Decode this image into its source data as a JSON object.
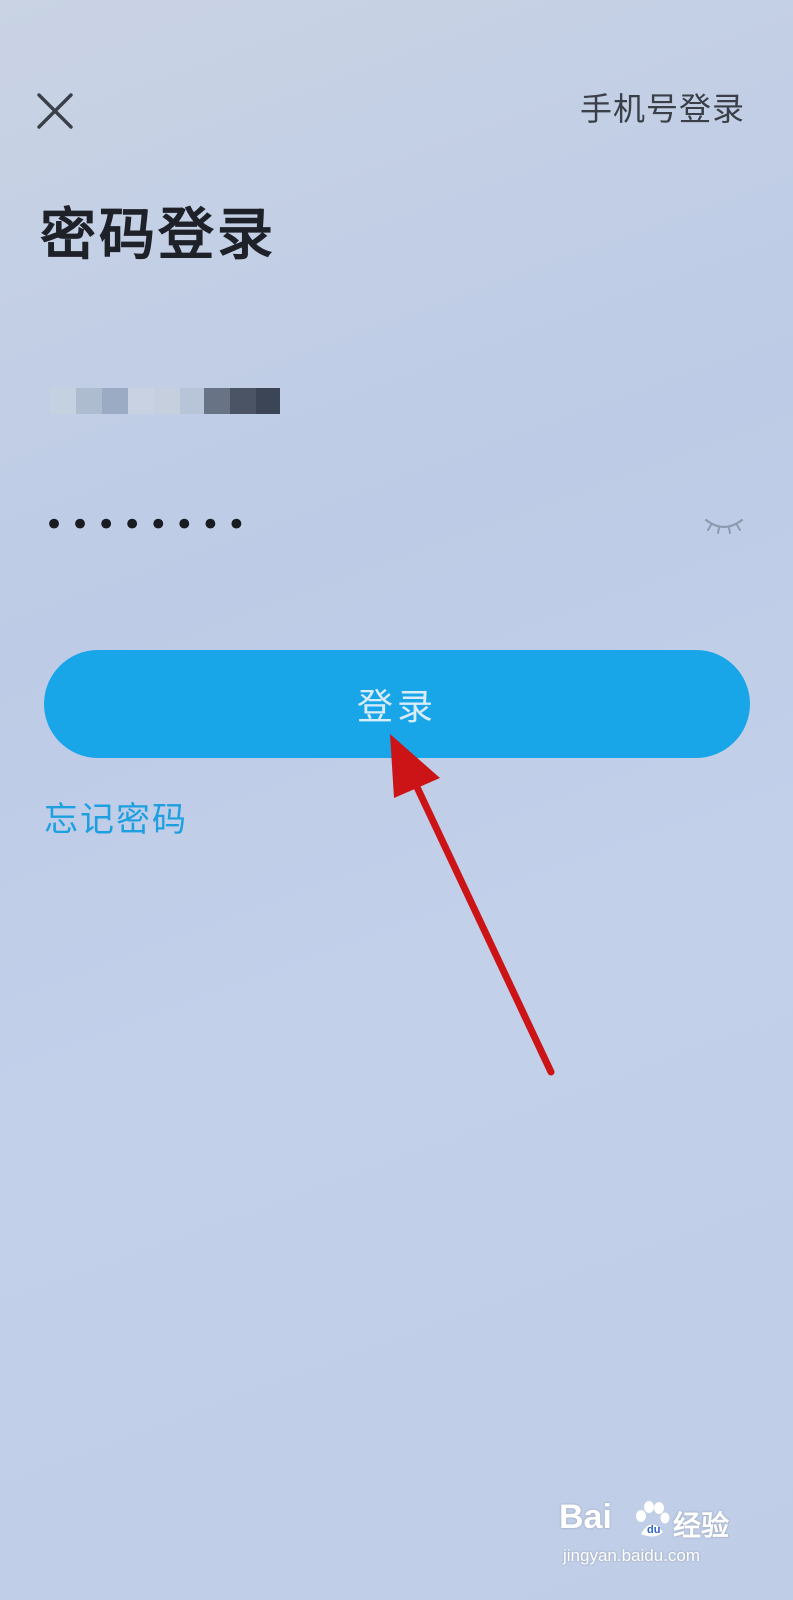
{
  "header": {
    "close_icon": "close-icon",
    "phone_login_label": "手机号登录"
  },
  "title": "密码登录",
  "account": {
    "value_state": "masked",
    "blocks": [
      "#c4d1e1",
      "#aebcd0",
      "#9aabc3",
      "#c8d2e2",
      "#c5cfde",
      "#b8c4d8",
      "#687386",
      "#4a5464",
      "#3b4555"
    ]
  },
  "password": {
    "value": "••••••••",
    "toggle_icon": "eye-closed-icon"
  },
  "login_button": {
    "label": "登录",
    "color": "#19a6e8"
  },
  "forgot_label": "忘记密码",
  "annotation": {
    "icon": "arrow-icon",
    "color": "#cc1416"
  },
  "watermark": {
    "brand": "Bai",
    "tag": "经验",
    "url": "jingyan.baidu.com"
  }
}
